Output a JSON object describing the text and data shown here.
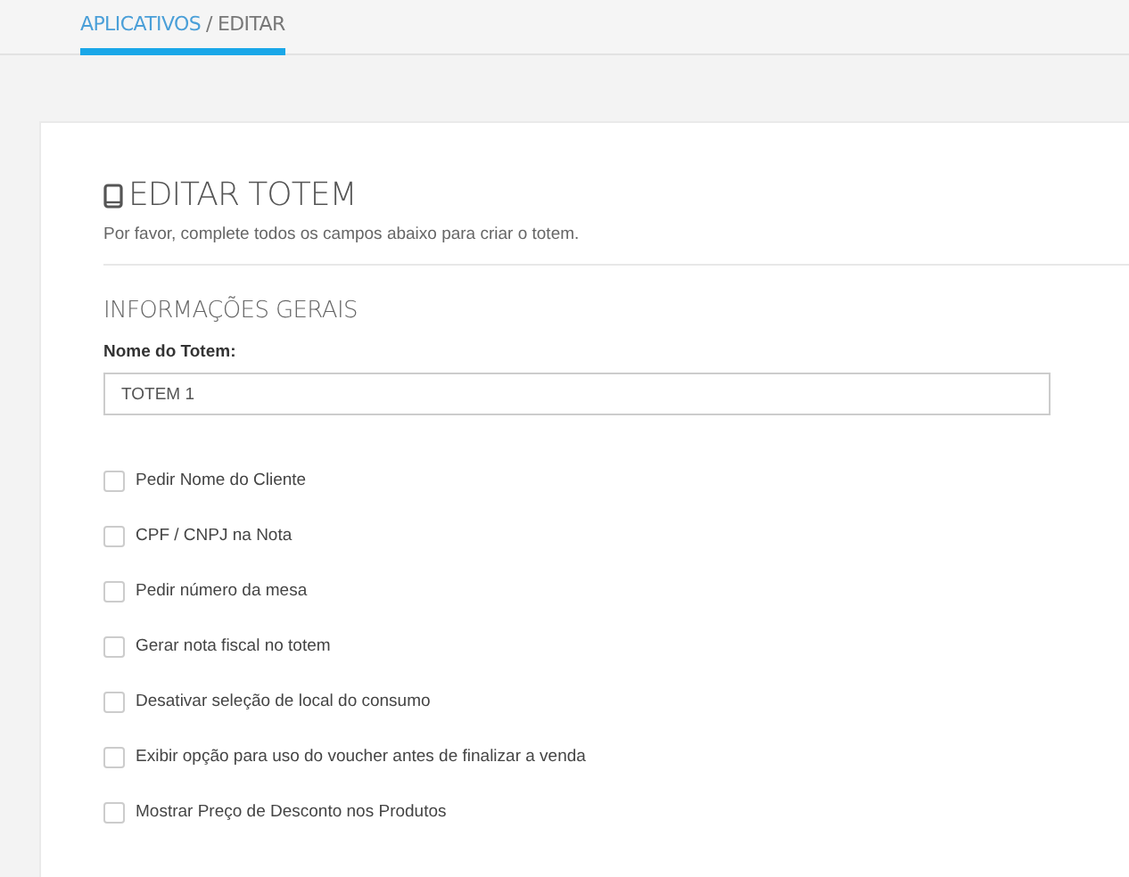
{
  "breadcrumb": {
    "link": "APLICATIVOS",
    "separator": "/",
    "current": "EDITAR"
  },
  "form": {
    "title": "EDITAR TOTEM",
    "subtitle": "Por favor, complete todos os campos abaixo para criar o totem.",
    "section": "INFORMAÇÕES GERAIS",
    "field": {
      "label": "Nome do Totem:",
      "value": "TOTEM 1"
    },
    "options": [
      {
        "label": "Pedir Nome do Cliente",
        "checked": false
      },
      {
        "label": "CPF / CNPJ na Nota",
        "checked": false
      },
      {
        "label": "Pedir número da mesa",
        "checked": false
      },
      {
        "label": "Gerar nota fiscal no totem",
        "checked": false
      },
      {
        "label": "Desativar seleção de local do consumo",
        "checked": false
      },
      {
        "label": "Exibir opção para uso do voucher antes de finalizar a venda",
        "checked": false
      },
      {
        "label": "Mostrar Preço de Desconto nos Produtos",
        "checked": false
      }
    ]
  }
}
